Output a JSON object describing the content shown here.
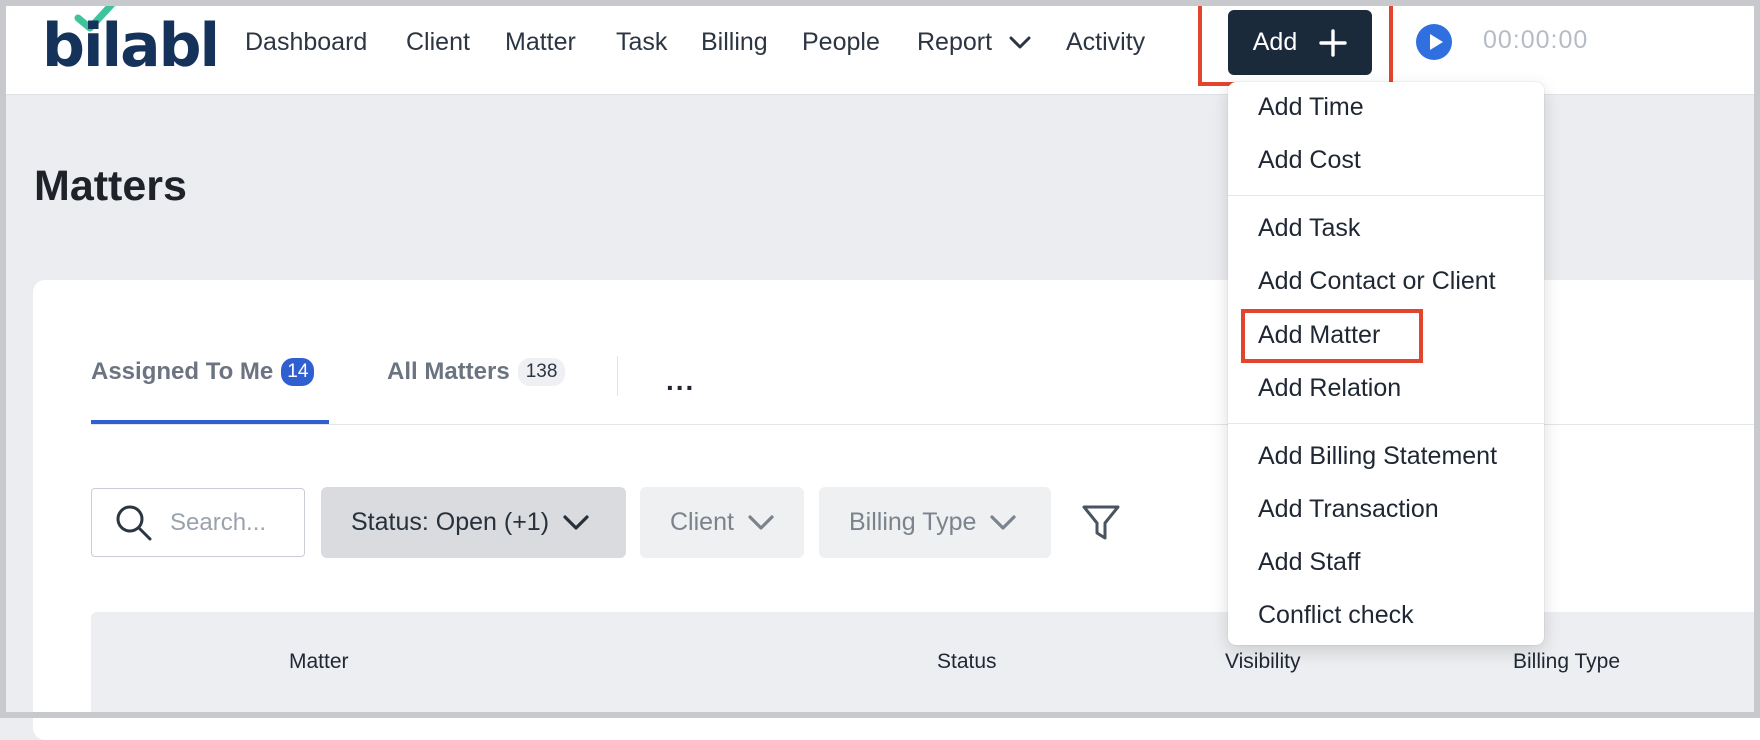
{
  "logo": {
    "text": "bilabl"
  },
  "nav": {
    "items": [
      "Dashboard",
      "Client",
      "Matter",
      "Task",
      "Billing",
      "People",
      "Report",
      "Activity"
    ],
    "add_label": "Add",
    "timer": "00:00:00"
  },
  "page": {
    "title": "Matters"
  },
  "tabs": [
    {
      "label": "Assigned To Me",
      "count": "14"
    },
    {
      "label": "All Matters",
      "count": "138"
    }
  ],
  "more_label": "...",
  "filters": {
    "search_placeholder": "Search...",
    "status": "Status: Open (+1)",
    "client": "Client",
    "billing_type": "Billing Type"
  },
  "table": {
    "columns": [
      "Matter",
      "Status",
      "Visibility",
      "Billing Type"
    ]
  },
  "add_menu": {
    "group1": [
      "Add Time",
      "Add Cost"
    ],
    "group2": [
      "Add Task",
      "Add Contact or Client",
      "Add Matter",
      "Add Relation"
    ],
    "group3": [
      "Add Billing Statement",
      "Add Transaction",
      "Add Staff",
      "Conflict check"
    ]
  },
  "colors": {
    "brand_navy": "#15325a",
    "brand_green": "#3fc39a",
    "accent_blue": "#2f5fd0",
    "highlight_red": "#e2452e"
  }
}
